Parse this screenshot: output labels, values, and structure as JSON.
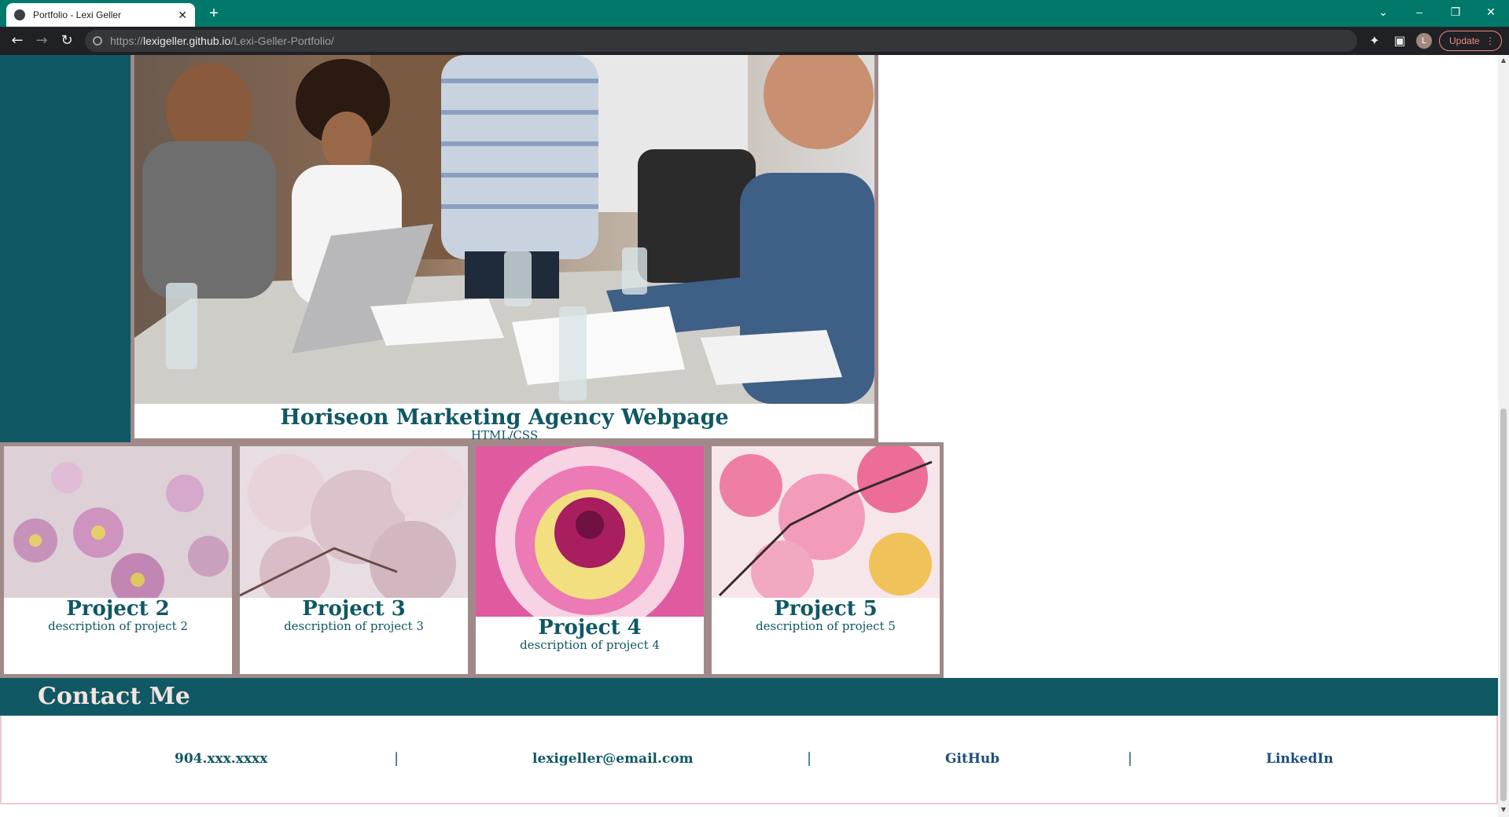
{
  "browser": {
    "tab_title": "Portfolio - Lexi Geller",
    "new_tab_symbol": "+",
    "url_prefix": "https://",
    "url_domain": "lexigeller.github.io",
    "url_path": "/Lexi-Geller-Portfolio/",
    "profile_initial": "L",
    "update_label": "Update"
  },
  "featured": {
    "title": "Horiseon Marketing Agency Webpage",
    "tech": "HTML/CSS"
  },
  "projects": [
    {
      "title": "Project 2",
      "description": "description of project 2"
    },
    {
      "title": "Project 3",
      "description": "description of project 3"
    },
    {
      "title": "Project 4",
      "description": "description of project 4"
    },
    {
      "title": "Project 5",
      "description": "description of project 5"
    }
  ],
  "contact": {
    "heading": "Contact Me",
    "phone": "904.xxx.xxxx",
    "email": "lexigeller@email.com",
    "github": "GitHub",
    "linkedin": "LinkedIn",
    "separator": "|"
  },
  "colors": {
    "teal": "#0f5864",
    "mauve": "#a1898a",
    "chrome_green": "#00796b"
  }
}
